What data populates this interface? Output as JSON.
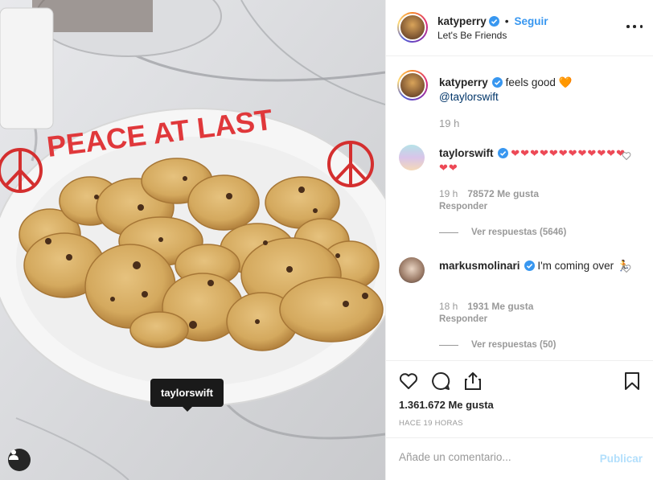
{
  "photo": {
    "caption_on_plate": "PEACE AT LAST",
    "tag_label": "taylorswift"
  },
  "header": {
    "username": "katyperry",
    "separator": "•",
    "follow_label": "Seguir",
    "location": "Let's Be Friends"
  },
  "caption": {
    "username": "katyperry",
    "text": "feels good",
    "emoji": "🧡",
    "mention": "@taylorswift",
    "time": "19 h"
  },
  "comments": [
    {
      "username": "taylorswift",
      "hearts": "❤❤❤❤❤❤❤❤❤❤❤❤❤❤",
      "time": "19 h",
      "likes": "78572 Me gusta",
      "reply_label": "Responder",
      "view_replies": "Ver respuestas (5646)"
    },
    {
      "username": "markusmolinari",
      "text": "I'm coming over",
      "emoji": "🏃",
      "time": "18 h",
      "likes": "1931 Me gusta",
      "reply_label": "Responder",
      "view_replies": "Ver respuestas (50)"
    }
  ],
  "actions": {
    "likes": "1.361.672 Me gusta",
    "posted": "HACE 19 HORAS"
  },
  "add_comment": {
    "placeholder": "Añade un comentario...",
    "publish_label": "Publicar"
  },
  "icons": {
    "like": "heart-outline-icon",
    "comment": "comment-bubble-icon",
    "share": "share-upload-icon",
    "save": "bookmark-icon",
    "more": "more-horizontal-icon",
    "verified": "verified-badge-icon",
    "user_tag": "user-tag-icon"
  },
  "colors": {
    "accent": "#3897f0",
    "verified": "#3897f0",
    "publish_disabled": "#b2dffc",
    "heart": "#ed4956",
    "muted": "#999999"
  }
}
